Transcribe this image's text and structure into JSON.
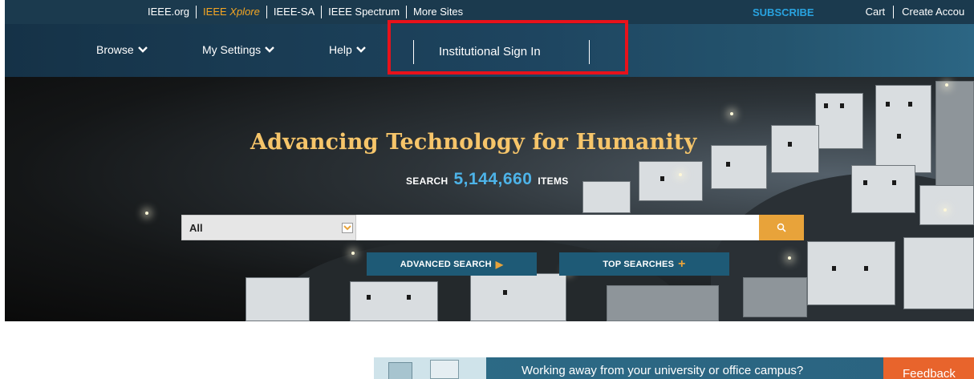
{
  "topbar": {
    "links": [
      "IEEE.org",
      "IEEE Xplore",
      "IEEE-SA",
      "IEEE Spectrum",
      "More Sites"
    ],
    "xplore_prefix": "IEEE ",
    "xplore_suffix": "Xplore",
    "subscribe": "SUBSCRIBE",
    "cart": "Cart",
    "create_account": "Create Accou"
  },
  "nav": {
    "browse": "Browse",
    "my_settings": "My Settings",
    "help": "Help",
    "institutional_sign_in": "Institutional Sign In",
    "highlight_color": "#e8121b"
  },
  "hero": {
    "title": "Advancing Technology for Humanity",
    "search_label": "SEARCH",
    "count": "5,144,660",
    "items_label": "ITEMS",
    "scope_value": "All",
    "search_placeholder": "",
    "advanced_search": "ADVANCED SEARCH",
    "top_searches": "TOP SEARCHES"
  },
  "banner": {
    "text": "Working away from your university or office campus?",
    "feedback": "Feedback"
  },
  "colors": {
    "accent_orange": "#e8a33a",
    "count_blue": "#4db3e8",
    "title_gold": "#f6c56a",
    "feedback_orange": "#e8642c"
  }
}
